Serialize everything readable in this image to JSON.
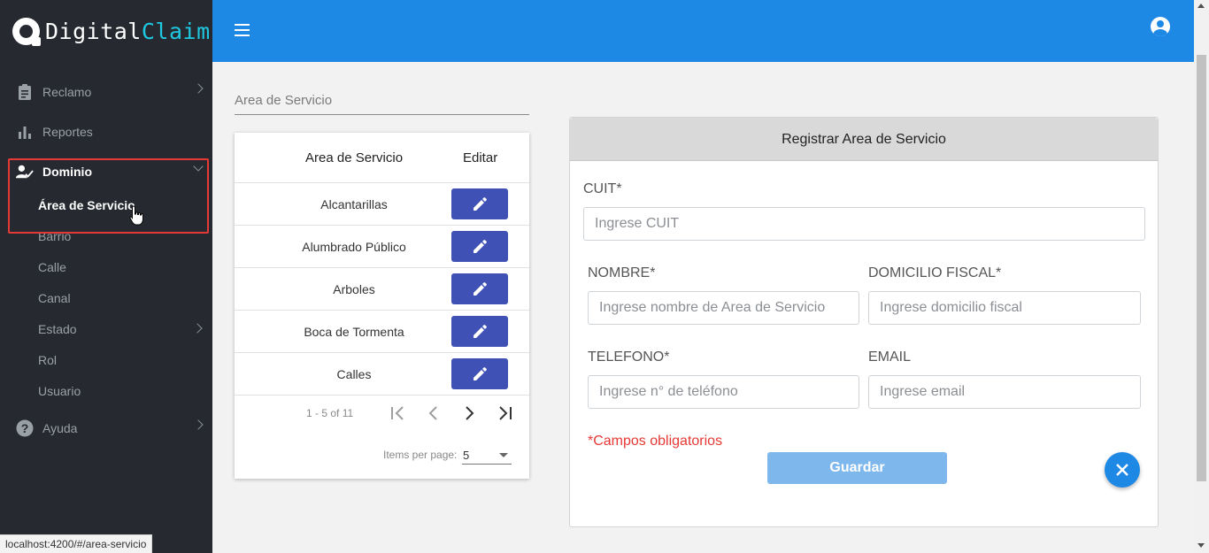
{
  "app": {
    "logo_part1": "Digital",
    "logo_part2": "Claim",
    "logo_color_primary": "#ffffff",
    "logo_color_accent": "#1ec8e0"
  },
  "sidebar": {
    "items": [
      {
        "label": "Reclamo",
        "icon": "clipboard-icon"
      },
      {
        "label": "Reportes",
        "icon": "bar-chart-icon"
      },
      {
        "label": "Dominio",
        "icon": "user-check-icon"
      },
      {
        "label": "Ayuda",
        "icon": "help-circle-icon"
      }
    ],
    "dominio_sub": [
      "Área de Servicio",
      "Barrio",
      "Calle",
      "Canal",
      "Estado",
      "Rol",
      "Usuario"
    ]
  },
  "status_url": "localhost:4200/#/area-servicio",
  "filter": {
    "placeholder": "Area de Servicio"
  },
  "table": {
    "col_name": "Area de Servicio",
    "col_edit": "Editar",
    "rows": [
      "Alcantarillas",
      "Alumbrado Público",
      "Arboles",
      "Boca de Tormenta",
      "Calles"
    ],
    "range_label": "1 - 5 of 11",
    "items_per_page_label": "Items per page:",
    "items_per_page_value": "5"
  },
  "form": {
    "title": "Registrar Area de Servicio",
    "cuit_label": "CUIT*",
    "cuit_placeholder": "Ingrese CUIT",
    "nombre_label": "NOMBRE*",
    "nombre_placeholder": "Ingrese nombre de Area de Servicio",
    "domicilio_label": "DOMICILIO FISCAL*",
    "domicilio_placeholder": "Ingrese domicilio fiscal",
    "telefono_label": "TELEFONO*",
    "telefono_placeholder": "Ingrese n° de teléfono",
    "email_label": "EMAIL",
    "email_placeholder": "Ingrese email",
    "required_note": "*Campos obligatorios",
    "save_label": "Guardar"
  },
  "colors": {
    "topbar": "#1e88e5",
    "sidebar": "#262a30",
    "edit_button": "#3f51b5",
    "save_button": "#7eb7ec",
    "highlight": "#e53935"
  }
}
